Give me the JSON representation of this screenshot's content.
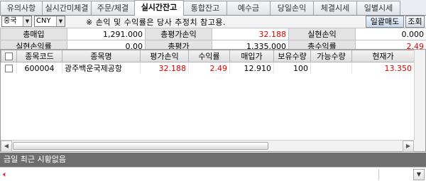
{
  "tabs": [
    {
      "label": "유의사항",
      "active": false
    },
    {
      "label": "실시간미체결",
      "active": false
    },
    {
      "label": "주문/체결",
      "active": false
    },
    {
      "label": "실시간잔고",
      "active": true
    },
    {
      "label": "통합잔고",
      "active": false
    },
    {
      "label": "예수금",
      "active": false
    },
    {
      "label": "당일손익",
      "active": false
    },
    {
      "label": "체결시세",
      "active": false
    },
    {
      "label": "일별시세",
      "active": false
    }
  ],
  "toolbar": {
    "country": "중국",
    "currency": "CNY",
    "note": "※ 손익 및 수익률은 당사 추정치 참고용.",
    "bulk_sell_label": "일괄매도",
    "inquiry_label": "조회"
  },
  "summary": {
    "total_buy_label": "총매입",
    "total_buy_value": "1,291.000",
    "total_eval_pnl_label": "총평가손익",
    "total_eval_pnl_value": "32.188",
    "realized_pnl_label": "실현손익",
    "realized_pnl_value": "0.000",
    "realized_rate_label": "실현손익률",
    "realized_rate_value": "0.00",
    "total_eval_label": "총평가",
    "total_eval_value": "1,335.000",
    "total_return_label": "총수익률",
    "total_return_value": "2.49"
  },
  "grid": {
    "columns": [
      "종목코드",
      "종목명",
      "평가손익",
      "수익률",
      "매입가",
      "보유수량",
      "가능수량",
      "현재가"
    ],
    "rows": [
      {
        "code": "600004",
        "name": "광주백운국제공항",
        "eval_pnl": "32.188",
        "return_rate": "2.49",
        "buy_price": "12.910",
        "holding_qty": "100",
        "available_qty": "",
        "current_price": "13.350"
      }
    ]
  },
  "status": {
    "message": "금일 최근 시황없음"
  },
  "colors": {
    "positive": "#e00000",
    "status_bar": "#6e6e6e"
  }
}
